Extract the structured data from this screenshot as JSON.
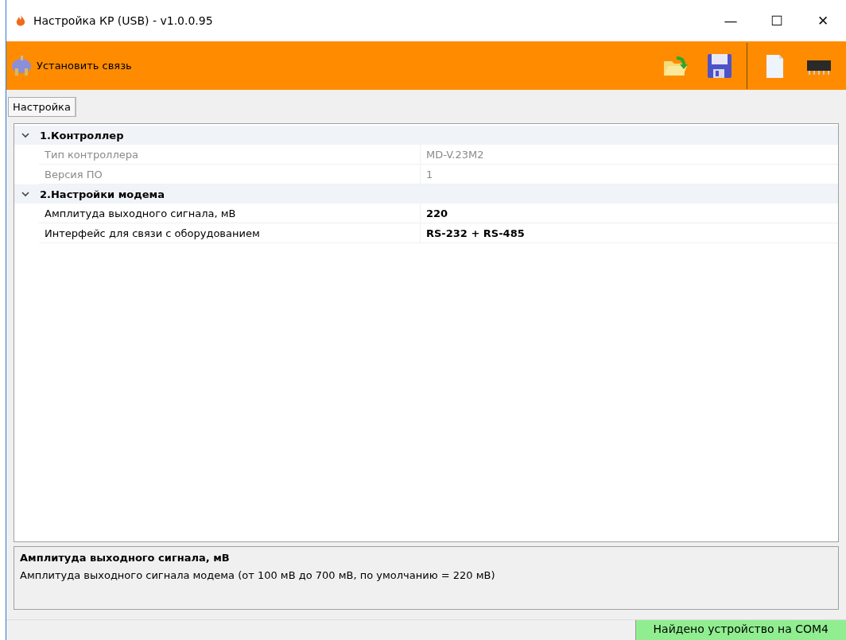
{
  "window": {
    "title": "Настройка КР (USB) - v1.0.0.95",
    "controls": [
      "—",
      "☐",
      "✕"
    ]
  },
  "toolbar": {
    "connect_button": "Установить связь"
  },
  "tabs": [
    {
      "label": "Настройка",
      "selected": true
    }
  ],
  "property_grid": {
    "categories": [
      {
        "title": "1.Контроллер",
        "expanded": true,
        "properties": [
          {
            "name": "Тип контроллера",
            "value": "MD-V.23M2",
            "readonly": true,
            "modified": false
          },
          {
            "name": "Версия ПО",
            "value": "1",
            "readonly": true,
            "modified": false
          }
        ]
      },
      {
        "title": "2.Настройки модема",
        "expanded": true,
        "properties": [
          {
            "name": "Амплитуда выходного сигнала, мВ",
            "value": "220",
            "readonly": false,
            "modified": true
          },
          {
            "name": "Интерфейс для связи с оборудованием",
            "value": "RS-232 + RS-485",
            "readonly": false,
            "modified": true
          }
        ]
      }
    ]
  },
  "description": {
    "title": "Амплитуда выходного сигнала, мВ",
    "text": "Амплитуда выходного сигнала модема (от 100 мВ до 700 мВ, по умолчанию = 220 мВ)"
  },
  "status_bar": {
    "text": "Найдено устройство на COM4"
  }
}
